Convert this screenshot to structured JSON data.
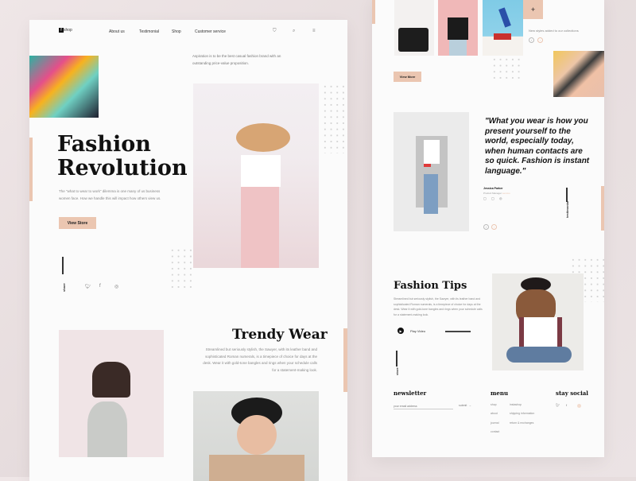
{
  "left_page": {
    "logo": {
      "mark": "f",
      "text": "shop"
    },
    "nav": [
      "About us",
      "Testimonial",
      "Shop",
      "Customer service"
    ],
    "header_icons": [
      "bag-icon",
      "search-icon",
      "menu-icon"
    ],
    "tagline": "Aspiration is to be the best casual fashion brand with an outstanding price-value proposition.",
    "hero": {
      "title_line1": "Fashion",
      "title_line2": "Revolution",
      "body": "The \"what to wear to work\" dilemma is one many of us business women face. How we handle this will impact how others view us.",
      "button": "View Store"
    },
    "share": {
      "label": "share",
      "icons": [
        "twitter-icon",
        "facebook-icon",
        "instagram-icon"
      ]
    },
    "trendy": {
      "title": "Trendy Wear",
      "body": "Streamlined but seriously stylish, the Sawyer, with its leather band and sophisticated Roman numerals, is a timepiece of choice for days at the desk. Wear it with gold-tone bangles and rings when your schedule calls for a statement-making look."
    }
  },
  "right_page": {
    "plus_button": "+",
    "collection_note": "New styles added to our collections",
    "view_more": "View More",
    "quote": "\"What you wear is how you present yourself to the world, especially today, when human contacts are so quick. Fashion is instant language.\"",
    "author": {
      "name": "Jessica Parker",
      "role": "Product Manager",
      "company": "Lenovo"
    },
    "testimonial_label": "testimonial",
    "tips": {
      "title": "Fashion Tips",
      "body": "Streamlined but seriously stylish, the Sawyer, with its leather band and sophisticated Roman numerals, is a timepiece of choice for days at the desk. Wear it with gold-tone bangles and rings when your schedule calls for a statement-making look.",
      "play": "Play Video",
      "side_label": "store"
    },
    "footer": {
      "newsletter": {
        "title": "newsletter",
        "placeholder": "your email address",
        "submit": "submit"
      },
      "menu": {
        "title": "menu",
        "col1": [
          "shop",
          "about",
          "journal",
          "contact"
        ],
        "col2": [
          "instashop",
          "shipping information",
          "return & exchanges"
        ]
      },
      "social": {
        "title": "stay social"
      }
    }
  },
  "colors": {
    "accent": "#ebc6b1",
    "text": "#111111",
    "background": "#fbfbfb"
  }
}
